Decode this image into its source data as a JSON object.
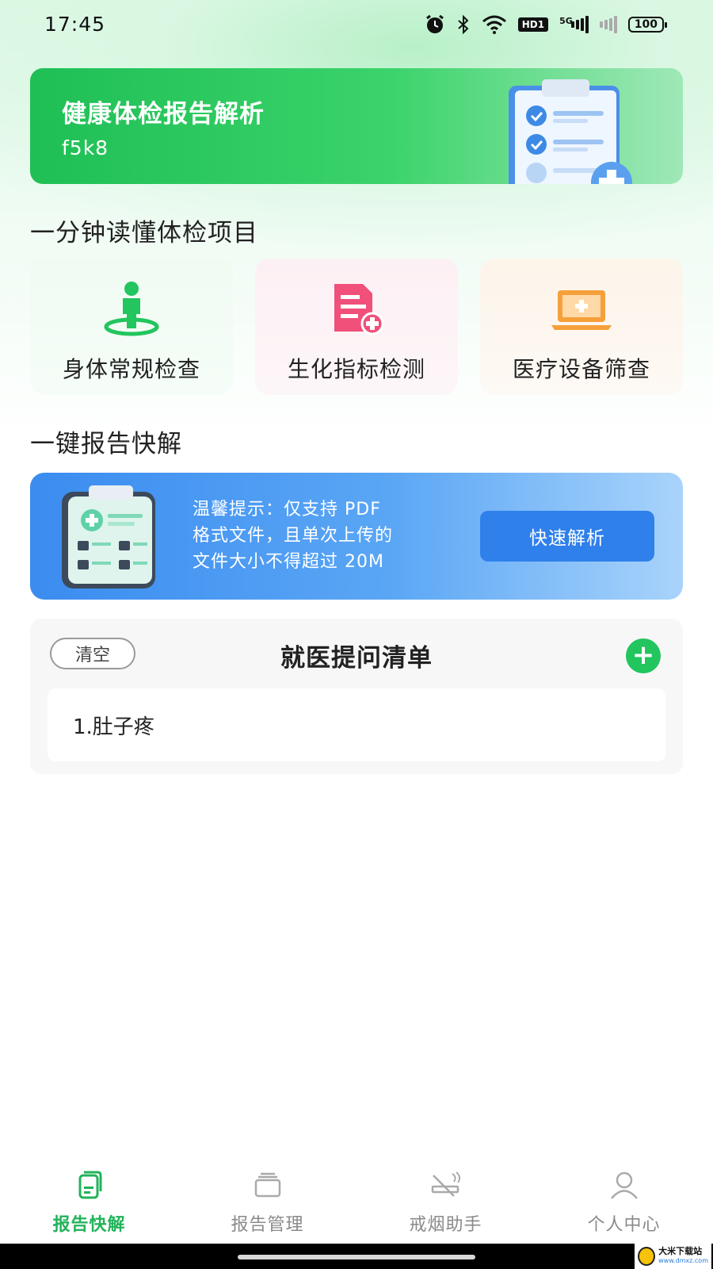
{
  "status_bar": {
    "time": "17:45",
    "network_label": "5G",
    "hd_label": "HD1",
    "battery": "100",
    "icons": [
      "alarm-icon",
      "bluetooth-icon",
      "wifi-icon",
      "hd-icon",
      "signal-5g-icon",
      "signal-icon",
      "battery-icon"
    ]
  },
  "hero": {
    "title": "健康体检报告解析",
    "subtitle": "f5k8"
  },
  "section_items": {
    "title": "一分钟读懂体检项目",
    "cards": [
      {
        "label": "身体常规检查",
        "icon": "person-location-icon",
        "color": "#22c55e"
      },
      {
        "label": "生化指标检测",
        "icon": "document-add-icon",
        "color": "#f0507a"
      },
      {
        "label": "医疗设备筛查",
        "icon": "laptop-medical-icon",
        "color": "#f5a03a"
      }
    ]
  },
  "section_report": {
    "title": "一键报告快解",
    "tip_line1": "温馨提示：仅支持 PDF",
    "tip_line2": "格式文件，且单次上传的",
    "tip_line3": "文件大小不得超过 20M",
    "button": "快速解析"
  },
  "question_list": {
    "clear_label": "清空",
    "title": "就医提问清单",
    "add_label": "+",
    "items": [
      "1.肚子疼"
    ]
  },
  "bottom_nav": {
    "items": [
      {
        "label": "报告快解",
        "icon": "report-icon",
        "active": true
      },
      {
        "label": "报告管理",
        "icon": "folder-icon",
        "active": false
      },
      {
        "label": "戒烟助手",
        "icon": "no-smoking-icon",
        "active": false
      },
      {
        "label": "个人中心",
        "icon": "user-icon",
        "active": false
      }
    ]
  },
  "watermark": {
    "line1": "大米下载站",
    "line2": "www.dmxz.com"
  },
  "colors": {
    "accent_green": "#22c55e",
    "accent_blue": "#3b8cf0",
    "button_blue": "#2f80ea"
  }
}
